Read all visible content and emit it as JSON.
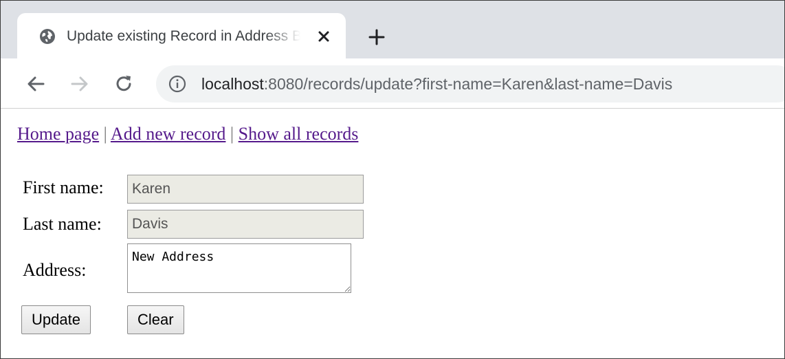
{
  "browser": {
    "tab": {
      "title": "Update existing Record in Address Book",
      "favicon": "globe-icon",
      "close_icon": "close-icon"
    },
    "new_tab_icon": "plus-icon",
    "toolbar": {
      "back_icon": "back-arrow-icon",
      "forward_icon": "forward-arrow-icon",
      "reload_icon": "reload-icon",
      "info_icon": "info-icon",
      "url_host": "localhost",
      "url_rest": ":8080/records/update?first-name=Karen&last-name=Davis"
    }
  },
  "nav": {
    "home": "Home page",
    "sep1": "|",
    "add": "Add new record",
    "sep2": "|",
    "show": "Show all records"
  },
  "form": {
    "first_name_label": "First name:",
    "first_name_value": "Karen",
    "last_name_label": "Last name:",
    "last_name_value": "Davis",
    "address_label": "Address:",
    "address_value": "New Address",
    "update_label": "Update",
    "clear_label": "Clear"
  },
  "colors": {
    "tab_strip": "#dee1e6",
    "omnibox": "#f1f3f4",
    "visited_link": "#551a8b",
    "disabled_input": "#ebebe4"
  }
}
